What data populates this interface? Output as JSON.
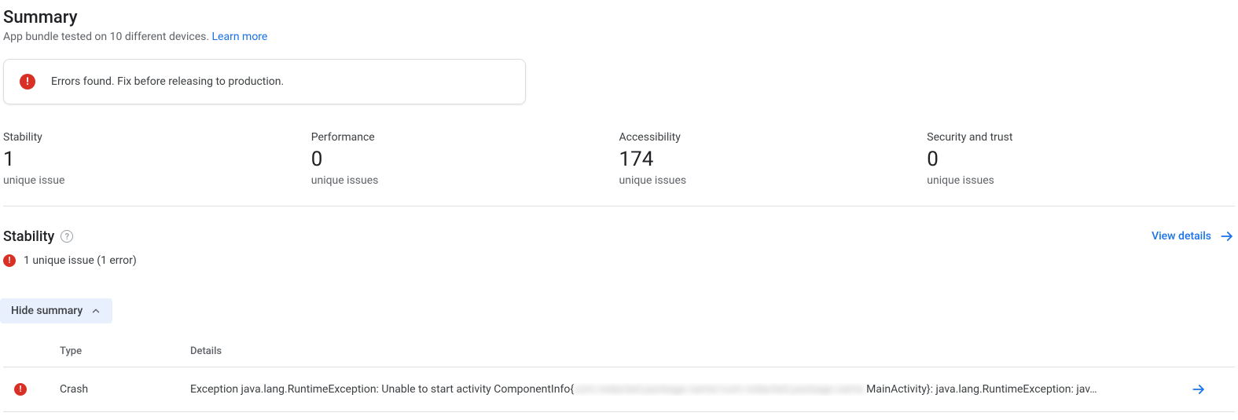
{
  "header": {
    "title": "Summary",
    "subtitle_text": "App bundle tested on 10 different devices. ",
    "learn_more": "Learn more"
  },
  "alert": {
    "message": "Errors found. Fix before releasing to production."
  },
  "metrics": [
    {
      "label": "Stability",
      "value": "1",
      "sub": "unique issue"
    },
    {
      "label": "Performance",
      "value": "0",
      "sub": "unique issues"
    },
    {
      "label": "Accessibility",
      "value": "174",
      "sub": "unique issues"
    },
    {
      "label": "Security and trust",
      "value": "0",
      "sub": "unique issues"
    }
  ],
  "stability": {
    "title": "Stability",
    "view_details": "View details",
    "issue_summary": "1 unique issue (1 error)",
    "hide_summary": "Hide summary",
    "columns": {
      "type": "Type",
      "details": "Details"
    },
    "rows": [
      {
        "type": "Crash",
        "details_pre": "Exception java.lang.RuntimeException: Unable to start activity ComponentInfo{",
        "details_blur": "com.redacted.package.name/com.redacted.package.name.",
        "details_post": "MainActivity}: java.lang.RuntimeException: jav…"
      }
    ]
  }
}
